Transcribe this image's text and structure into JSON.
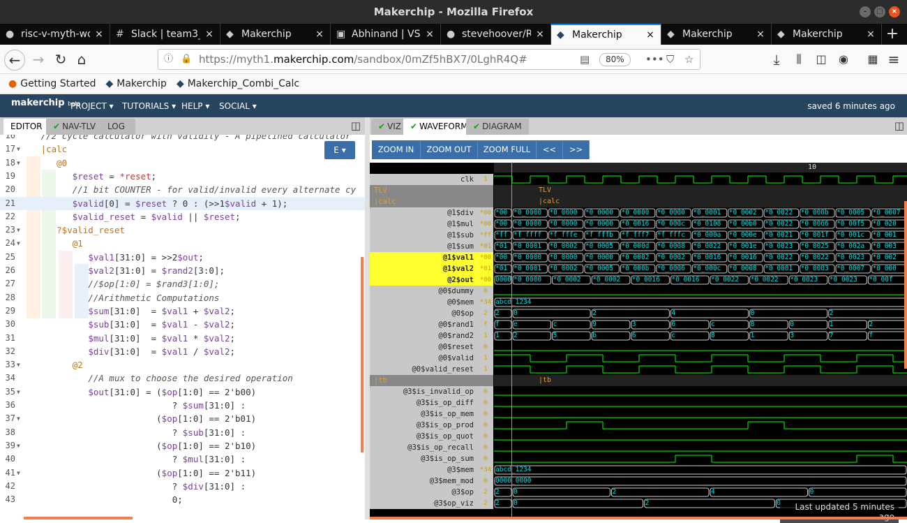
{
  "window": {
    "title": "Makerchip - Mozilla Firefox"
  },
  "tabs": [
    {
      "label": "risc-v-myth-wo",
      "icon": "github-icon"
    },
    {
      "label": "Slack | team3_",
      "icon": "slack-icon"
    },
    {
      "label": "Makerchip",
      "icon": "makerchip-icon"
    },
    {
      "label": "Abhinand | VSI",
      "icon": "vsi-icon"
    },
    {
      "label": "stevehoover/R",
      "icon": "github-icon"
    },
    {
      "label": "Makerchip",
      "icon": "makerchip-icon",
      "active": true
    },
    {
      "label": "Makerchip",
      "icon": "makerchip-icon"
    },
    {
      "label": "Makerchip",
      "icon": "makerchip-icon"
    }
  ],
  "url": {
    "prefix": "https://myth1.",
    "domain": "makerchip.com",
    "path": "/sandbox/0mZf5hBX7/0LghR4Q#",
    "zoom": "80%"
  },
  "bookmarks": [
    "Getting Started",
    "Makerchip",
    "Makerchip_Combi_Calc"
  ],
  "makerchip": {
    "logo": "makerchip",
    "logo_sub": "beta",
    "menu": [
      "PROJECT",
      "TUTORIALS",
      "HELP",
      "SOCIAL"
    ],
    "saved": "saved 6 minutes ago"
  },
  "left_tabs": [
    "EDITOR",
    "NAV-TLV",
    "LOG"
  ],
  "editor_dropdown": "E",
  "right_tabs": [
    "VIZ",
    "WAVEFORM",
    "DIAGRAM"
  ],
  "wf_buttons": [
    "ZOOM IN",
    "ZOOM OUT",
    "ZOOM FULL",
    "<<",
    ">>"
  ],
  "code_lines": [
    {
      "n": "16",
      "t": "   //2 cycle calculator with validity - A pipelined calculator"
    },
    {
      "n": "17",
      "t": "   |calc"
    },
    {
      "n": "18",
      "t": "      @0"
    },
    {
      "n": "19",
      "t": "         $reset = *reset;"
    },
    {
      "n": "20",
      "t": "         //1 bit COUNTER - for valid/invalid every alternate cy"
    },
    {
      "n": "21",
      "t": "         $valid[0] = $reset ? 0 : (>>1$valid + 1);"
    },
    {
      "n": "22",
      "t": "         $valid_reset = $valid || $reset;"
    },
    {
      "n": "23",
      "t": "      ?$valid_reset"
    },
    {
      "n": "24",
      "t": "         @1"
    },
    {
      "n": "25",
      "t": "            $val1[31:0] = >>2$out;"
    },
    {
      "n": "26",
      "t": "            $val2[31:0] = $rand2[3:0];"
    },
    {
      "n": "27",
      "t": "            //$op[1:0] = $rand3[1:0];"
    },
    {
      "n": "28",
      "t": "            //Arithmetic Computations"
    },
    {
      "n": "29",
      "t": "            $sum[31:0]  = $val1 + $val2;"
    },
    {
      "n": "30",
      "t": "            $sub[31:0]  = $val1 - $val2;"
    },
    {
      "n": "31",
      "t": "            $mul[31:0]  = $val1 * $val2;"
    },
    {
      "n": "32",
      "t": "            $div[31:0]  = $val1 / $val2;"
    },
    {
      "n": "33",
      "t": "         @2"
    },
    {
      "n": "34",
      "t": "            //A mux to choose the desired operation"
    },
    {
      "n": "35",
      "t": "            $out[31:0] = ($op[1:0] == 2'b00)"
    },
    {
      "n": "36",
      "t": "                            ? $sum[31:0] :"
    },
    {
      "n": "37",
      "t": "                         ($op[1:0] == 2'b01)"
    },
    {
      "n": "38",
      "t": "                            ? $sub[31:0] :"
    },
    {
      "n": "39",
      "t": "                         ($op[1:0] == 2'b10)"
    },
    {
      "n": "40",
      "t": "                            ? $mul[31:0] :"
    },
    {
      "n": "41",
      "t": "                         ($op[1:0] == 2'b11)"
    },
    {
      "n": "42",
      "t": "                            ? $div[31:0] :"
    },
    {
      "n": "43",
      "t": "                            0;"
    }
  ],
  "waveform": {
    "cycle_marker": "10",
    "signals": [
      {
        "name": "clk",
        "v": "1"
      },
      {
        "name": "TLV",
        "v": "",
        "scope": true,
        "scopeLabel": "TLV"
      },
      {
        "name": "|calc",
        "v": "",
        "scope": true,
        "scopeLabel": "|calc"
      },
      {
        "name": "@1$div",
        "v": "*00",
        "vals": [
          "*00",
          "*0_0000",
          "*0_0000",
          "*0_0000",
          "*0_0000",
          "*0_0000",
          "*0_0001",
          "*0_0002",
          "*0_0022",
          "*0_000b",
          "*0_0005",
          "*0_0007"
        ]
      },
      {
        "name": "@1$mul",
        "v": "*00",
        "vals": [
          "*00",
          "*0_0000",
          "*0_0000",
          "*0_0000",
          "*0_0016",
          "*0_000c",
          "*0_0108",
          "*0_00b0",
          "*0_0022",
          "*0_0066",
          "*0_00f5",
          "*0_020"
        ]
      },
      {
        "name": "@1$sub",
        "v": "*ff",
        "vals": [
          "*ff",
          "*f_ffff",
          "*f_fffe",
          "*f_fffb",
          "*f_fff7",
          "*f_fffc",
          "*0_000a",
          "*0_000e",
          "*0_0021",
          "*0_001f",
          "*0_001c",
          "*0_001"
        ]
      },
      {
        "name": "@1$sum",
        "v": "*01",
        "vals": [
          "*01",
          "*0_0001",
          "*0_0002",
          "*0_0005",
          "*0_000d",
          "*0_0008",
          "*0_0022",
          "*0_001e",
          "*0_0023",
          "*0_0025",
          "*0_002a",
          "*0_003"
        ]
      },
      {
        "name": "@1$val1",
        "v": "*00",
        "yel": true,
        "vals": [
          "*00",
          "*0_0000",
          "*0_0000",
          "*0_0000",
          "*0_0002",
          "*0_0002",
          "*0_0016",
          "*0_0016",
          "*0_0022",
          "*0_0022",
          "*0_0023",
          "*0_002"
        ]
      },
      {
        "name": "@1$val2",
        "v": "*01",
        "yel": true,
        "vals": [
          "*01",
          "*0_0001",
          "*0_0002",
          "*0_0005",
          "*0_000b",
          "*0_0006",
          "*0_000c",
          "*0_0008",
          "*0_0001",
          "*0_0003",
          "*0_0007",
          "*0_000"
        ]
      },
      {
        "name": "@2$out",
        "v": "*00",
        "yel": true,
        "vals": [
          "0000_0000",
          "*0_0000",
          "*0_0002",
          "*0_0002",
          "*0_0016",
          "*0_0016",
          "*0_0022",
          "*0_0022",
          "*0_0023",
          "*0_0023",
          "*0_00f"
        ]
      },
      {
        "name": "@0$dummy",
        "v": "0",
        "vals": []
      },
      {
        "name": "@0$mem",
        "v": "*34",
        "vals": [
          "abcd_1234"
        ]
      },
      {
        "name": "@0$op",
        "v": "2",
        "vals": [
          "2",
          "0",
          "2",
          "4",
          "0",
          "2"
        ]
      },
      {
        "name": "@0$rand1",
        "v": "f",
        "vals": [
          "f",
          "e",
          "c",
          "9",
          "3",
          "6",
          "c",
          "8",
          "0",
          "1",
          "2"
        ]
      },
      {
        "name": "@0$rand2",
        "v": "1",
        "vals": [
          "1",
          "2",
          "5",
          "b",
          "6",
          "c",
          "8",
          "1",
          "3",
          "7",
          "f"
        ]
      },
      {
        "name": "@0$reset",
        "v": "0",
        "vals": []
      },
      {
        "name": "@0$valid",
        "v": "1",
        "vals": []
      },
      {
        "name": "@0$valid_reset",
        "v": "1",
        "vals": []
      },
      {
        "name": "|tb",
        "v": "",
        "scope": true,
        "scopeLabel": "|tb"
      },
      {
        "name": "@3$is_invalid_op",
        "v": "0",
        "vals": []
      },
      {
        "name": "@3$is_op_diff",
        "v": "0",
        "vals": []
      },
      {
        "name": "@3$is_op_mem",
        "v": "0",
        "vals": []
      },
      {
        "name": "@3$is_op_prod",
        "v": "0",
        "vals": []
      },
      {
        "name": "@3$is_op_quot",
        "v": "0",
        "vals": []
      },
      {
        "name": "@3$is_op_recall",
        "v": "0",
        "vals": []
      },
      {
        "name": "@3$is_op_sum",
        "v": "0",
        "vals": []
      },
      {
        "name": "@3$mem",
        "v": "*34",
        "vals": [
          "abcd_1234"
        ]
      },
      {
        "name": "@3$mem_mod",
        "v": "0",
        "vals": [
          "0000_0000"
        ]
      },
      {
        "name": "@3$op",
        "v": "2",
        "vals": [
          "2",
          "0",
          "2",
          "4",
          "0"
        ]
      },
      {
        "name": "@3$op_viz",
        "v": "2",
        "vals": [
          "2",
          "0",
          "2",
          "0"
        ]
      }
    ],
    "last_updated": "Last updated 5 minutes ago"
  },
  "colors": {
    "accent": "#0a84ff",
    "header": "#27455e",
    "wave_green": "#00e000",
    "bus_cyan": "#00e0e0",
    "highlight": "#ffff30"
  }
}
